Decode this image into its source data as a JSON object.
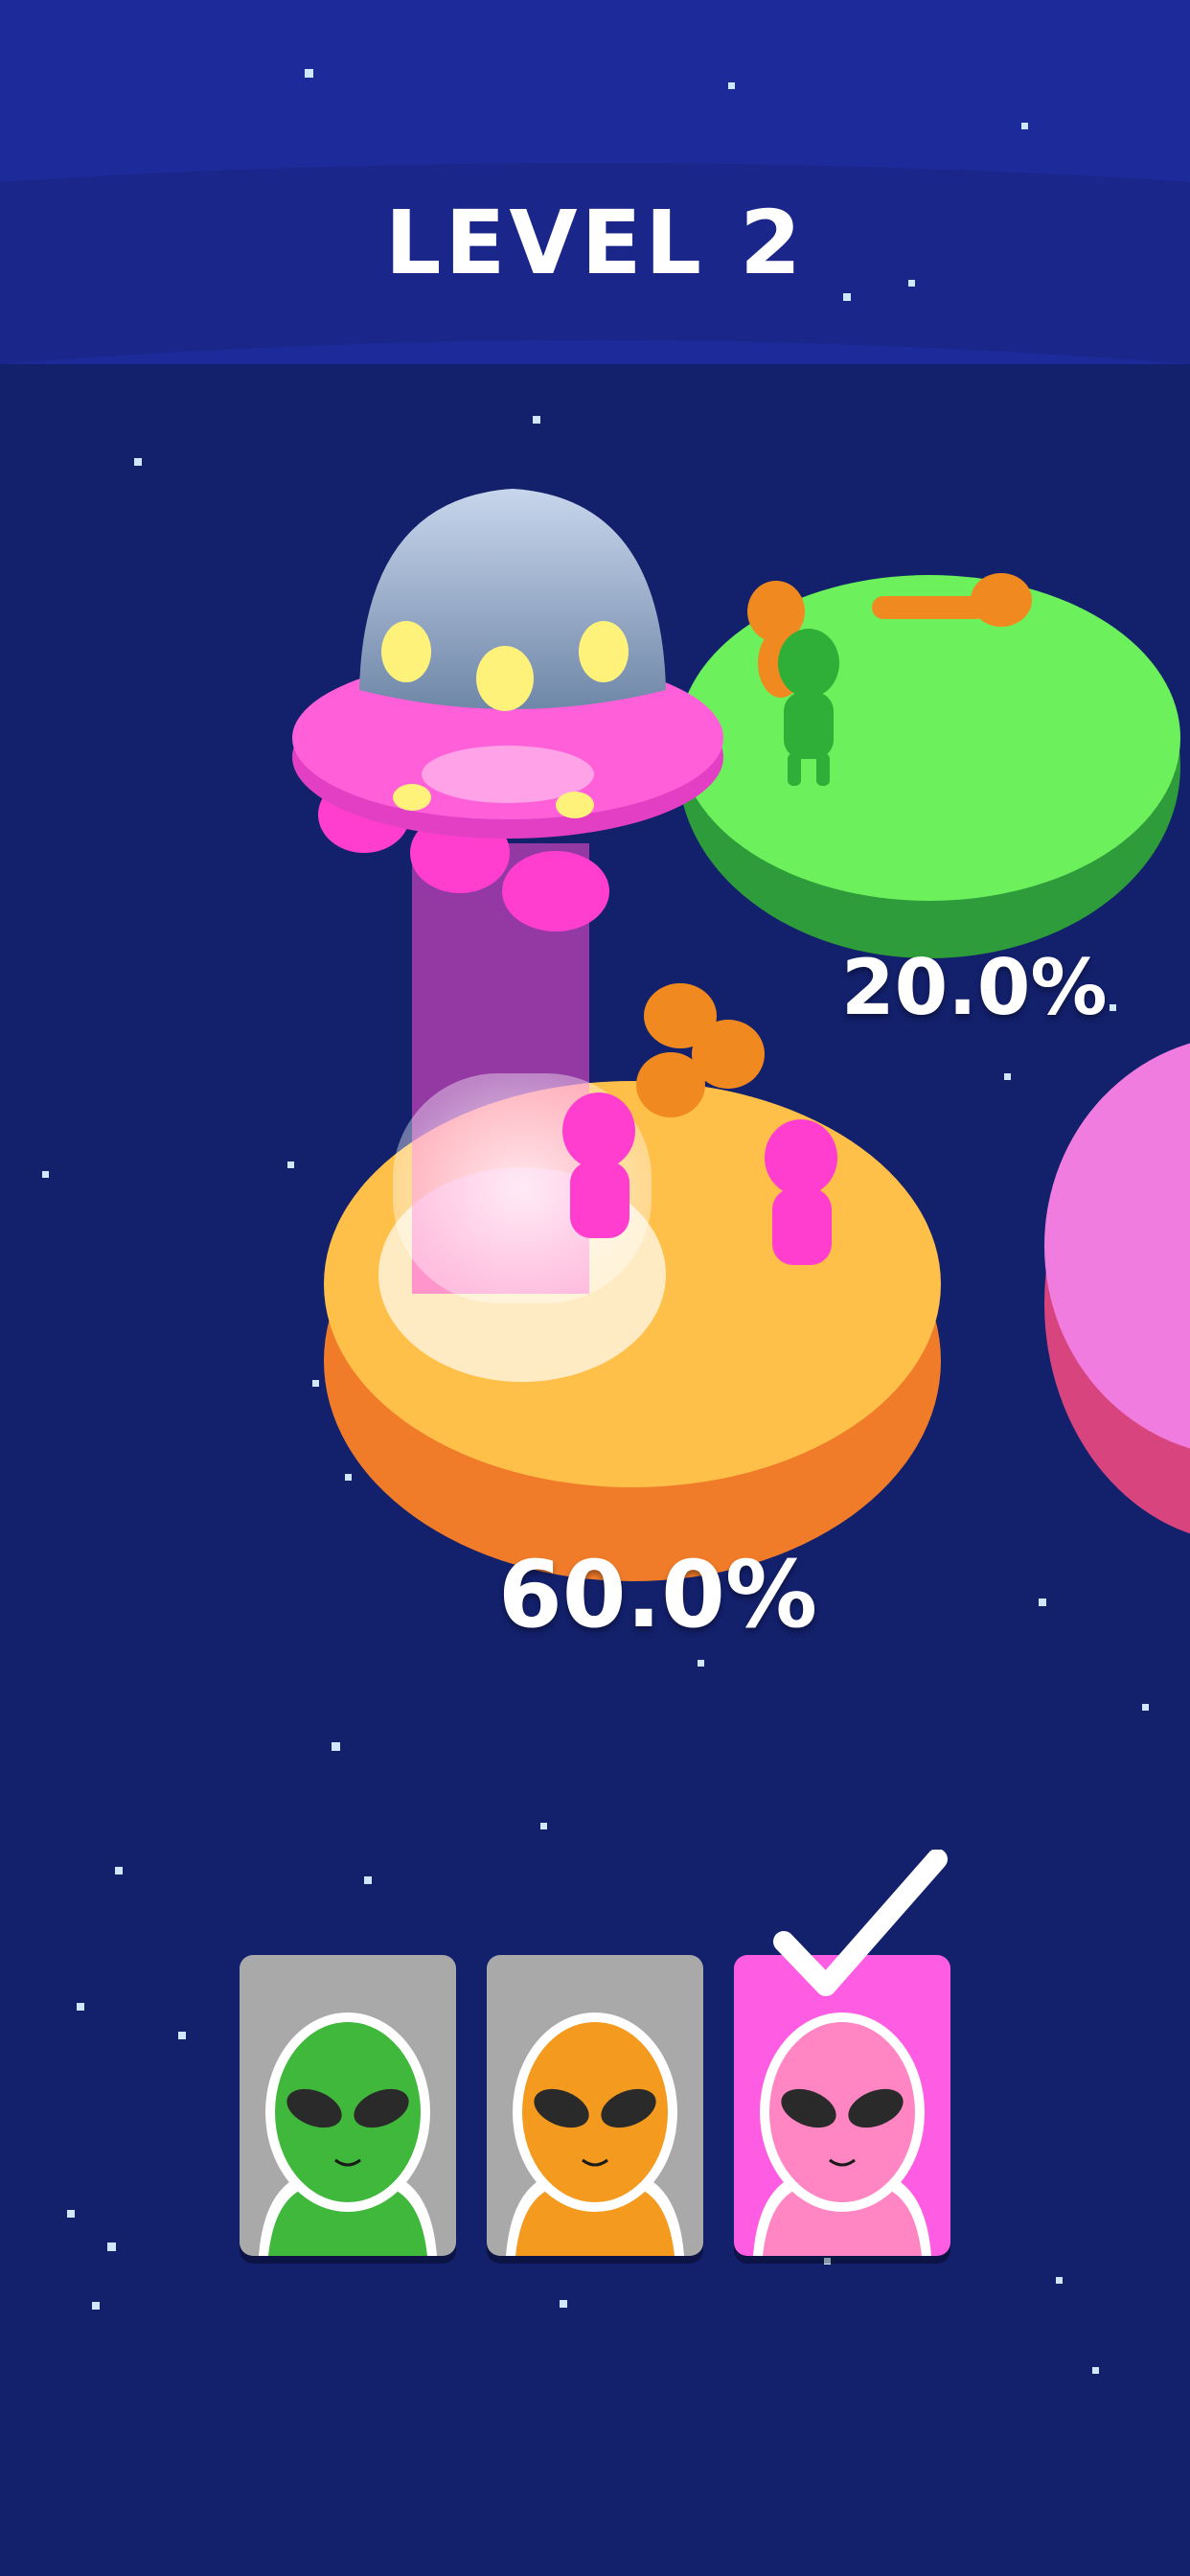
{
  "hud": {
    "level_title": "LEVEL 2"
  },
  "islands": [
    {
      "id": "green",
      "color": "#6cf05c",
      "percent_label": "20.0%"
    },
    {
      "id": "orange",
      "color": "#ffc04a",
      "percent_label": "60.0%"
    },
    {
      "id": "pink",
      "color": "#f07ce0",
      "percent_label": ""
    }
  ],
  "alien_picker": {
    "cards": [
      {
        "id": "green",
        "alien_color": "#3fb83c",
        "selected": false
      },
      {
        "id": "orange",
        "alien_color": "#f39a1f",
        "selected": false
      },
      {
        "id": "pink",
        "alien_color": "#ff86c2",
        "selected": true
      }
    ]
  },
  "colors": {
    "space_background": "#13206b",
    "card_unselected": "#a9a9a9",
    "card_selected": "#ff5ce4",
    "ufo_rim": "#ff5fd8",
    "ufo_dome": "#9fb8d8"
  },
  "icons": [
    "ufo-icon",
    "alien-head-icon",
    "checkmark-icon"
  ]
}
